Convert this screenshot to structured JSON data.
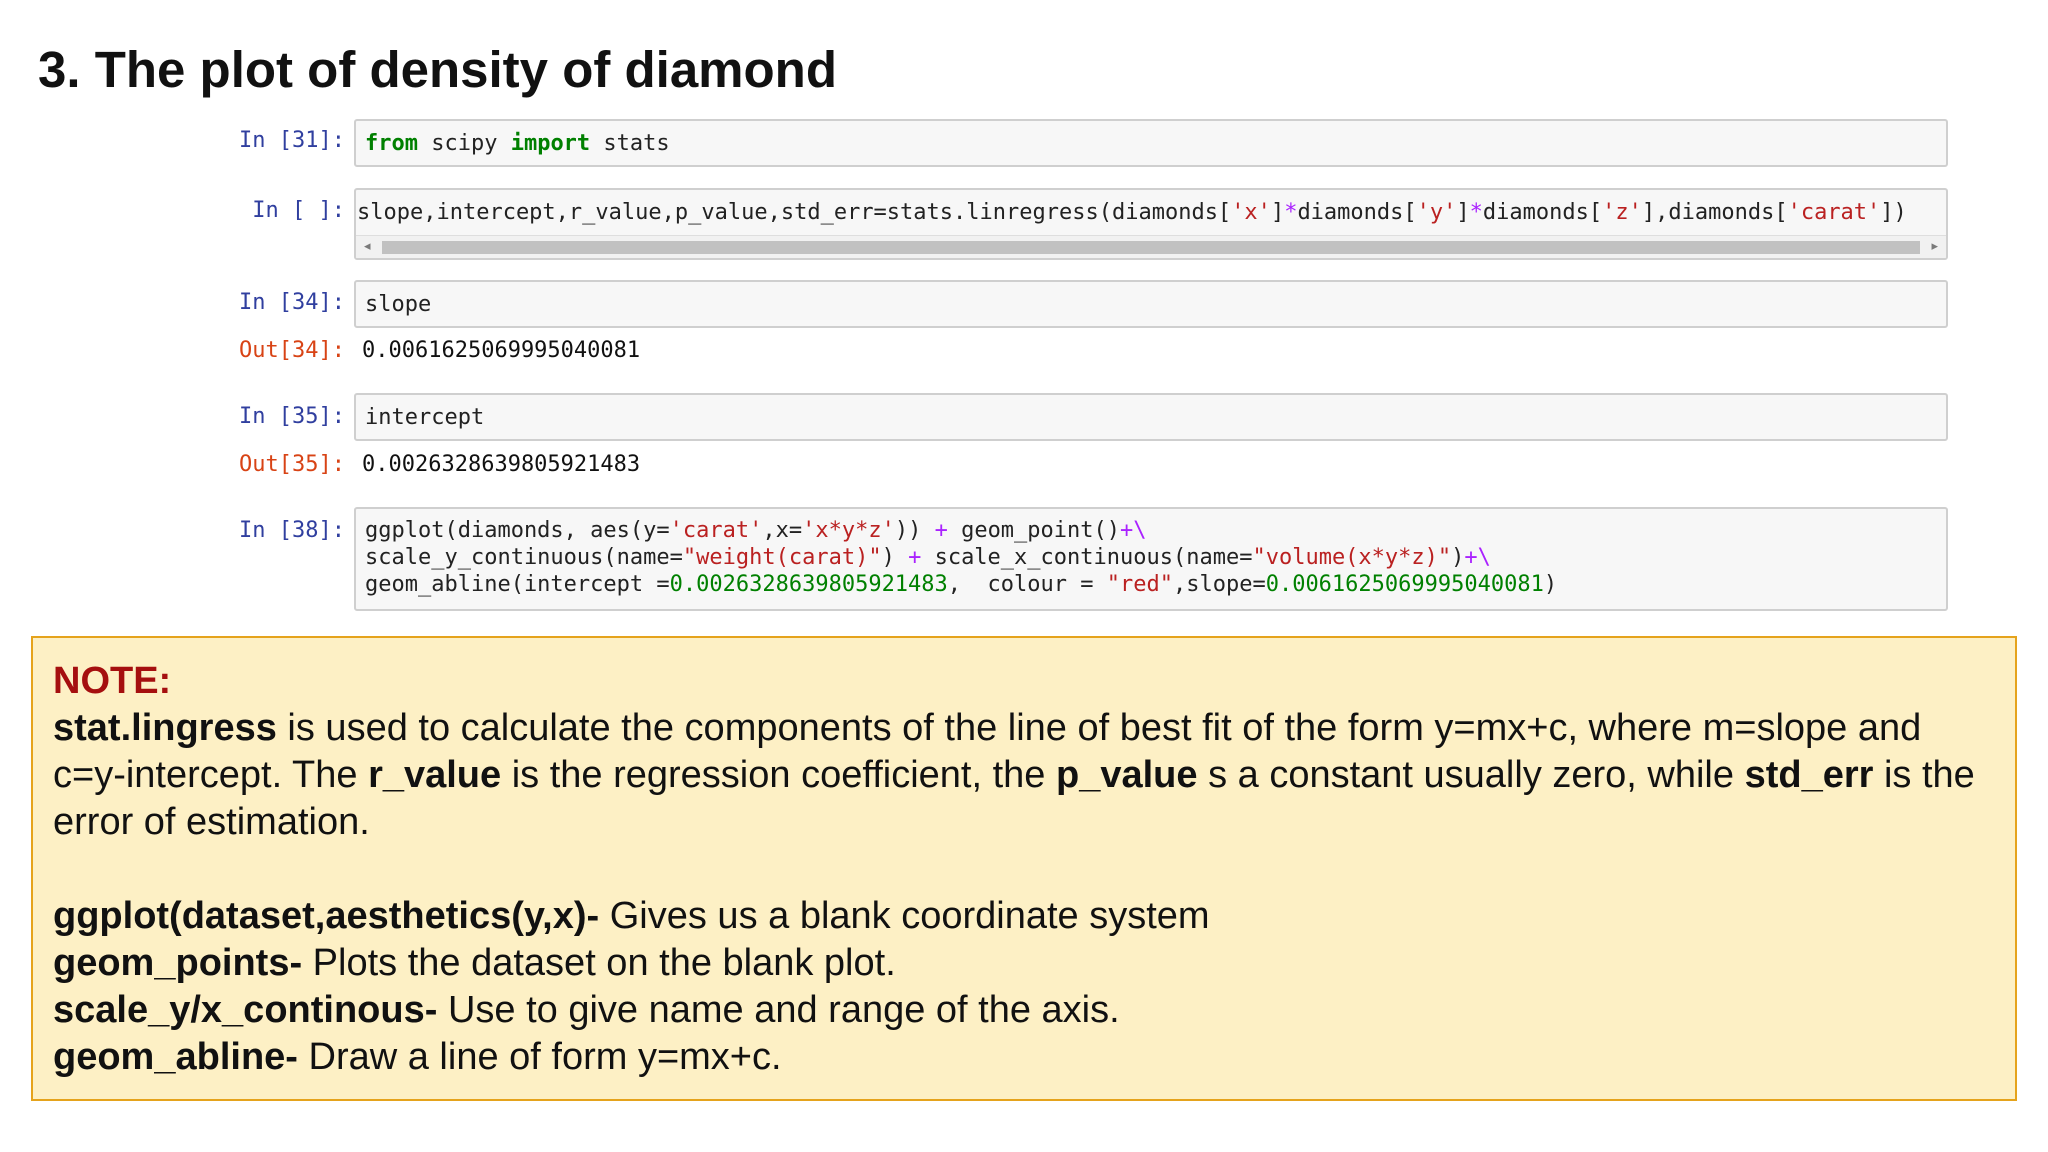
{
  "title": "3. The plot of density of diamond",
  "cells": [
    {
      "prompt": "In [31]:",
      "tokens": [
        "from",
        " scipy ",
        "import",
        " stats"
      ]
    },
    {
      "prompt": "In [ ]:",
      "tokens": [
        "slope,intercept,r_value,p_value,std_err=stats.linregress(diamonds[",
        "'x'",
        "]",
        "*",
        "diamonds[",
        "'y'",
        "]",
        "*",
        "diamonds[",
        "'z'",
        "],diamonds[",
        "'carat'",
        "])"
      ],
      "has_scrollbar": true
    },
    {
      "prompt": "In [34]:",
      "tokens": [
        "slope"
      ],
      "output_prompt": "Out[34]:",
      "output": "0.0061625069995040081"
    },
    {
      "prompt": "In [35]:",
      "tokens": [
        "intercept"
      ],
      "output_prompt": "Out[35]:",
      "output": "0.0026328639805921483"
    },
    {
      "prompt": "In [38]:",
      "lines": [
        [
          "ggplot(diamonds, aes(y=",
          "'carat'",
          ",x=",
          "'x*y*z'",
          ")) ",
          "+",
          " geom_point()",
          "+\\"
        ],
        [
          "scale_y_continuous(name=",
          "\"weight(carat)\"",
          ") ",
          "+",
          " scale_x_continuous(name=",
          "\"volume(x*y*z)\"",
          ")",
          "+\\"
        ],
        [
          "geom_abline(intercept =",
          "0.0026328639805921483",
          ",  colour = ",
          "\"red\"",
          ",slope=",
          "0.0061625069995040081",
          ")"
        ]
      ]
    }
  ],
  "note": {
    "heading": "NOTE:",
    "para1": [
      {
        "b": "stat.lingress"
      },
      {
        "t": " is used to calculate the components of the line of best fit of the form y=mx+c, where m=slope and c=y-intercept. The "
      },
      {
        "b": "r_value"
      },
      {
        "t": " is the regression coefficient, the "
      },
      {
        "b": "p_value"
      },
      {
        "t": " s a constant usually zero, while "
      },
      {
        "b": "std_err"
      },
      {
        "t": " is the error of estimation."
      }
    ],
    "defs": [
      {
        "term": "ggplot(dataset,aesthetics(y,x)-",
        "desc": " Gives us a blank coordinate system"
      },
      {
        "term": "geom_points-",
        "desc": " Plots the dataset on the blank plot."
      },
      {
        "term": "scale_y/x_continous-",
        "desc": " Use to give name and range of the axis."
      },
      {
        "term": "geom_abline-",
        "desc": " Draw a line of form y=mx+c."
      }
    ]
  },
  "colors": {
    "in_prompt": "#303f9f",
    "out_prompt": "#d84315",
    "keyword": "#008000",
    "string": "#ba2121",
    "operator": "#aa22ff",
    "note_bg": "#fdf0c5",
    "note_border": "#e5a31c",
    "note_heading": "#a50f0f"
  },
  "icons": {
    "scroll_left": "◂",
    "scroll_right": "▸"
  }
}
